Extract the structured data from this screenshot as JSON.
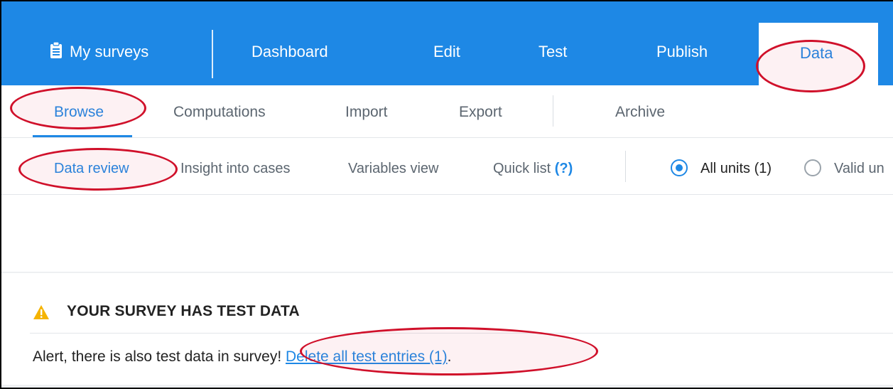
{
  "topnav": {
    "my_surveys": "My surveys",
    "dashboard": "Dashboard",
    "edit": "Edit",
    "test": "Test",
    "publish": "Publish",
    "data": "Data"
  },
  "subnav": {
    "browse": "Browse",
    "computations": "Computations",
    "import": "Import",
    "export": "Export",
    "archive": "Archive"
  },
  "thirdnav": {
    "data_review": "Data review",
    "insight": "Insight into cases",
    "variables": "Variables view",
    "quick_list": "Quick list",
    "quick_help": "(?)",
    "all_units": "All units (1)",
    "valid_units": "Valid un"
  },
  "alert": {
    "title": "YOUR SURVEY HAS TEST DATA",
    "message": "Alert, there is also test data in survey! ",
    "link": "Delete all test entries (1)",
    "suffix": "."
  },
  "colors": {
    "primary": "#1e88e5",
    "annotation": "#d0102a",
    "warning": "#f5b400"
  },
  "icons": {
    "my_surveys": "clipboard-icon",
    "alert": "warning-triangle-icon"
  }
}
